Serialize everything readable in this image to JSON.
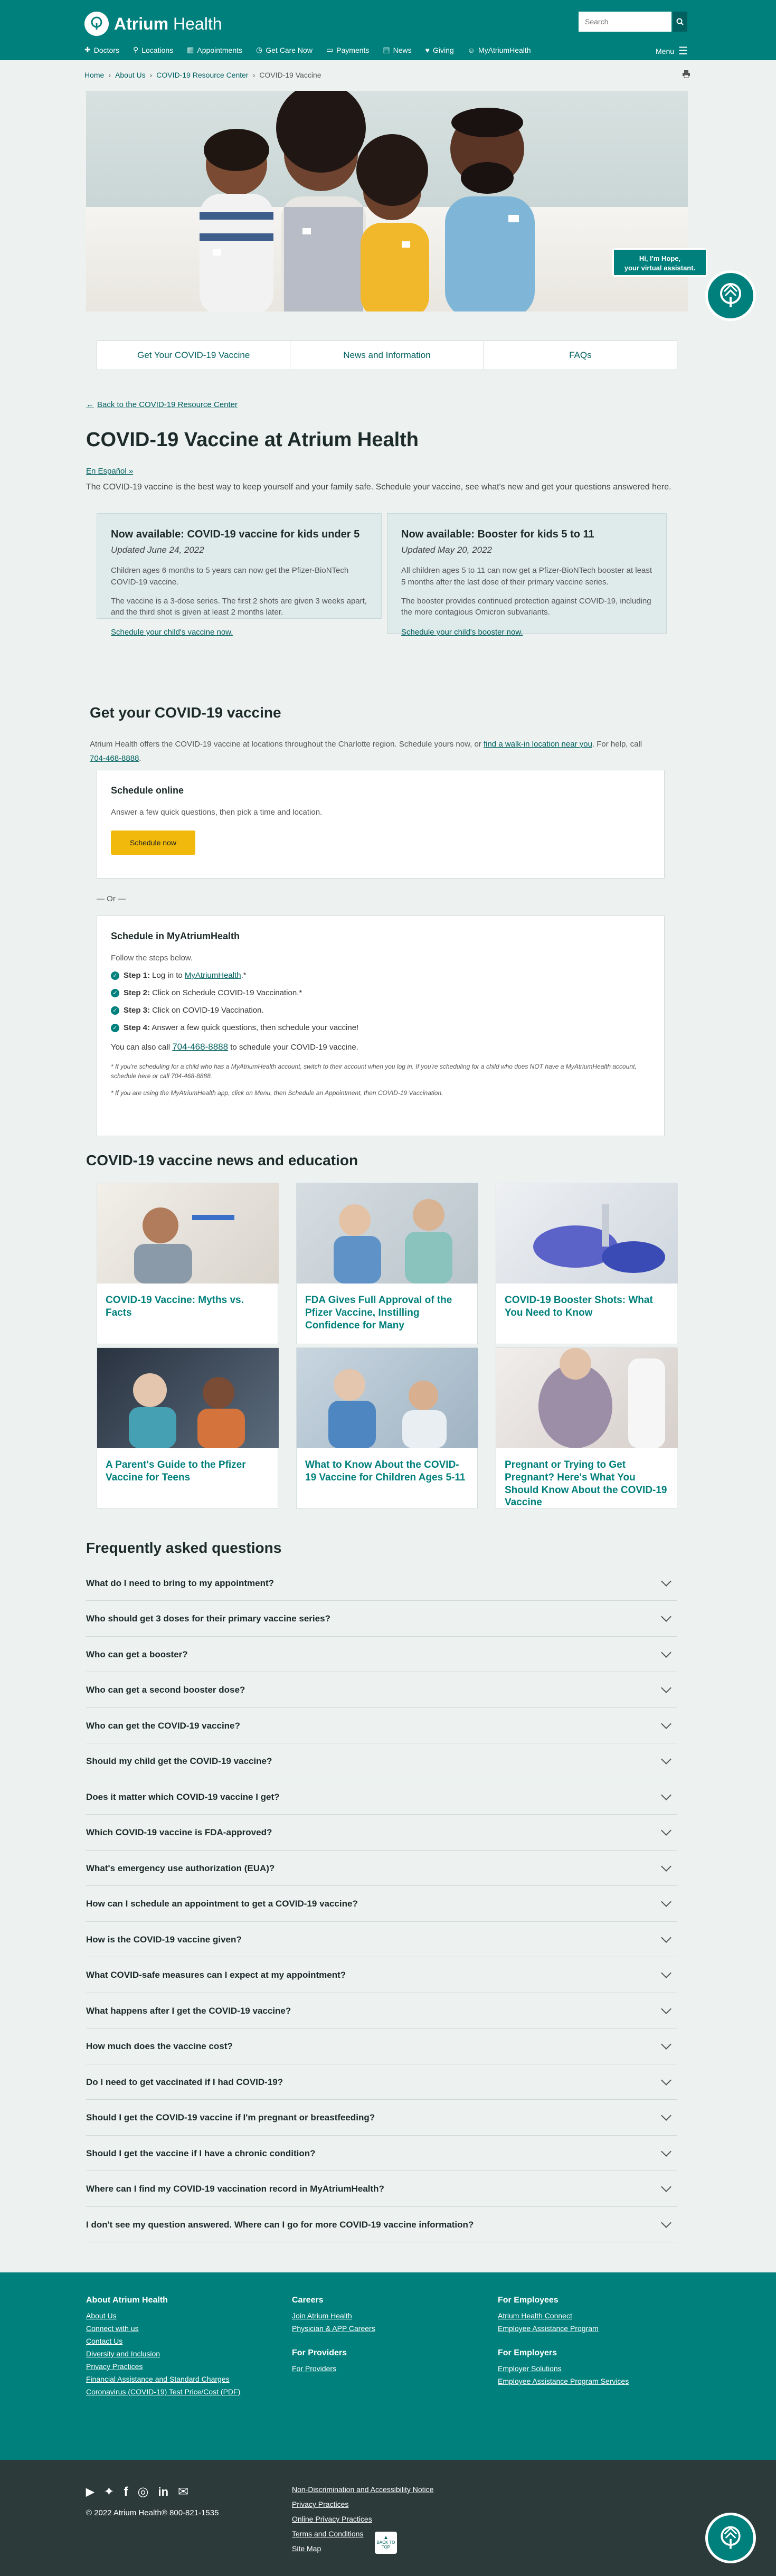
{
  "header": {
    "logo_text_bold": "Atrium",
    "logo_text_rest": " Health",
    "search_placeholder": "Search",
    "nav": [
      "Doctors",
      "Locations",
      "Appointments",
      "Get Care Now",
      "Payments",
      "News",
      "Giving",
      "MyAtriumHealth"
    ],
    "menu_label": "Menu"
  },
  "breadcrumb": [
    "Home",
    "About Us",
    "COVID-19 Resource Center",
    "COVID-19 Vaccine"
  ],
  "hero": {
    "hope_line1": "Hi, I'm Hope,",
    "hope_line2": "your virtual assistant."
  },
  "tabs": [
    "Get Your COVID-19 Vaccine",
    "News and Information",
    "FAQs"
  ],
  "back_link": "Back to the COVID-19 Resource Center",
  "page_title": "COVID-19 Vaccine at Atrium Health",
  "espanol": "En Español »",
  "intro": "The COVID-19 vaccine is the best way to keep yourself and your family safe. Schedule your vaccine, see what's new and get your questions answered here.",
  "cards": [
    {
      "title": "Now available: COVID-19 vaccine for kids under 5",
      "updated": "Updated June 24, 2022",
      "p1": "Children ages 6 months to 5 years can now get the Pfizer-BioNTech COVID-19 vaccine.",
      "p2": "The vaccine is a 3-dose series. The first 2 shots are given 3 weeks apart, and the third shot is given at least 2 months later.",
      "link": "Schedule your child's vaccine now."
    },
    {
      "title": "Now available: Booster for kids 5 to 11",
      "updated": "Updated May 20, 2022",
      "p1": "All children ages 5 to 11 can now get a Pfizer-BioNTech booster at least 5 months after the last dose of their primary vaccine series.",
      "p2": "The booster provides continued protection against COVID-19, including the more contagious Omicron subvariants.",
      "link": "Schedule your child's booster now."
    }
  ],
  "get_vaccine": {
    "title": "Get your COVID-19 vaccine",
    "text_a": "Atrium Health offers the COVID-19 vaccine at locations throughout the Charlotte region. Schedule yours now, or ",
    "text_link": "find a walk-in location near you",
    "text_b": ". For help, call",
    "phone": "704-468-8888",
    "online_title": "Schedule online",
    "online_text": "Answer a few quick questions, then pick a time and location.",
    "schedule_btn": "Schedule now",
    "or": "— Or —",
    "mah_title": "Schedule in MyAtriumHealth",
    "mah_intro": "Follow the steps below.",
    "steps": [
      {
        "label": "Step 1:",
        "text": " Log in to ",
        "link": "MyAtriumHealth",
        "tail": ".*"
      },
      {
        "label": "Step 2:",
        "text": " Click on Schedule COVID-19 Vaccination.*",
        "link": "",
        "tail": ""
      },
      {
        "label": "Step 3:",
        "text": " Click on COVID-19 Vaccination.",
        "link": "",
        "tail": ""
      },
      {
        "label": "Step 4:",
        "text": " Answer a few quick questions, then schedule your vaccine!",
        "link": "",
        "tail": ""
      }
    ],
    "also_call_a": "You can also call ",
    "also_call_phone": "704-468-8888",
    "also_call_b": " to schedule your COVID-19 vaccine.",
    "note1": "* If you're scheduling for a child who has a MyAtriumHealth account, switch to their account when you log in. If you're scheduling for a child who does NOT have a MyAtriumHealth account, schedule here or call 704-468-8888.",
    "note2": "* If you are using the MyAtriumHealth app, click on Menu, then Schedule an Appointment, then COVID-19 Vaccination."
  },
  "news": {
    "title": "COVID-19 vaccine news and education",
    "items": [
      "COVID-19 Vaccine: Myths vs. Facts",
      "FDA Gives Full Approval of the Pfizer Vaccine, Instilling Confidence for Many",
      "COVID-19 Booster Shots: What You Need to Know",
      "A Parent's Guide to the Pfizer Vaccine for Teens",
      "What to Know About the COVID-19 Vaccine for Children Ages 5-11",
      "Pregnant or Trying to Get Pregnant? Here's What You Should Know About the COVID-19 Vaccine"
    ]
  },
  "faq": {
    "title": "Frequently asked questions",
    "items": [
      "What do I need to bring to my appointment?",
      "Who should get 3 doses for their primary vaccine series?",
      "Who can get a booster?",
      "Who can get a second booster dose?",
      "Who can get the COVID-19 vaccine?",
      "Should my child get the COVID-19 vaccine?",
      "Does it matter which COVID-19 vaccine I get?",
      "Which COVID-19 vaccine is FDA-approved?",
      "What's emergency use authorization (EUA)?",
      "How can I schedule an appointment to get a COVID-19 vaccine?",
      "How is the COVID-19 vaccine given?",
      "What COVID-safe measures can I expect at my appointment?",
      "What happens after I get the COVID-19 vaccine?",
      "How much does the vaccine cost?",
      "Do I need to get vaccinated if I had COVID-19?",
      "Should I get the COVID-19 vaccine if I'm pregnant or breastfeeding?",
      "Should I get the vaccine if I have a chronic condition?",
      "Where can I find my COVID-19 vaccination record in MyAtriumHealth?",
      "I don't see my question answered. Where can I go for more COVID-19 vaccine information?"
    ]
  },
  "footer": {
    "about_title": "About Atrium Health",
    "about_links": [
      "About Us",
      "Connect with us",
      "Contact Us",
      "Diversity and Inclusion",
      "Privacy Practices",
      "Financial Assistance and Standard Charges",
      "Coronavirus (COVID-19) Test Price/Cost (PDF)"
    ],
    "careers_title": "Careers",
    "careers_links": [
      "Join Atrium Health",
      "Physician & APP Careers"
    ],
    "providers_title": "For Providers",
    "providers_links": [
      "For Providers"
    ],
    "employees_title": "For Employees",
    "employees_links": [
      "Atrium Health Connect",
      "Employee Assistance Program"
    ],
    "employers_title": "For Employers",
    "employers_links": [
      "Employer Solutions",
      "Employee Assistance Program Services"
    ],
    "copyright": "© 2022 Atrium Health® 800-821-1535",
    "legal_links": [
      "Non-Discrimination and Accessibility Notice",
      "Privacy Practices",
      "Online Privacy Practices",
      "Terms and Conditions",
      "Site Map"
    ],
    "back_to_top": "BACK TO TOP"
  },
  "colors": {
    "brand": "#00807c",
    "accent": "#f0b90b",
    "dark": "#2c3a3a"
  }
}
